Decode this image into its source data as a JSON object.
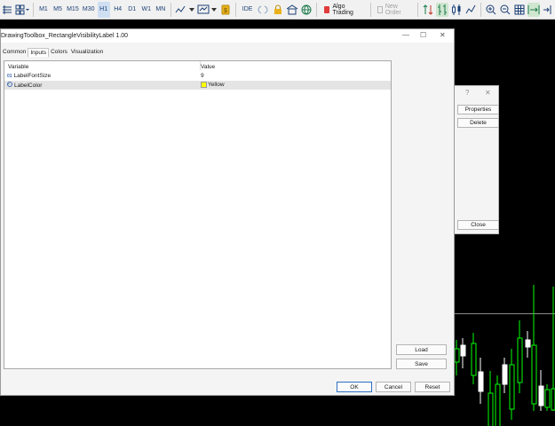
{
  "toolbar": {
    "timeframes": [
      "M1",
      "M5",
      "M15",
      "M30",
      "H1",
      "H4",
      "D1",
      "W1",
      "MN"
    ],
    "active_timeframe": "H1",
    "ide_label": "IDE",
    "algo_trading_label": "Algo Trading",
    "new_order_label": "New Order",
    "colors": {
      "accent": "#1b3f75",
      "algo_icon": "#e23b3b",
      "active_bg": "#cfdff2"
    }
  },
  "dialog": {
    "title": "DrawingToolbox_RectangleVisibilityLabel 1.00",
    "tabs": [
      "Common",
      "Inputs",
      "Colors",
      "Visualization"
    ],
    "active_tab": "Inputs",
    "columns": {
      "variable": "Variable",
      "value": "Value"
    },
    "rows": [
      {
        "icon": "01",
        "variable": "LabelFontSize",
        "value": "9"
      },
      {
        "icon": "palette",
        "variable": "LabelColor",
        "value": "Yellow",
        "color": "#ffff00"
      }
    ],
    "buttons": {
      "load": "Load",
      "save": "Save",
      "ok": "OK",
      "cancel": "Cancel",
      "reset": "Reset"
    }
  },
  "properties_dialog": {
    "title_help": "?",
    "title_close": "✕",
    "buttons": {
      "properties": "Properties",
      "delete": "Delete",
      "close": "Close"
    }
  },
  "chart": {
    "candle_colors": {
      "bull_fill": "#000000",
      "bull_border": "#00ff00",
      "bear_fill": "#ffffff",
      "bear_border": "#ffffff"
    }
  }
}
